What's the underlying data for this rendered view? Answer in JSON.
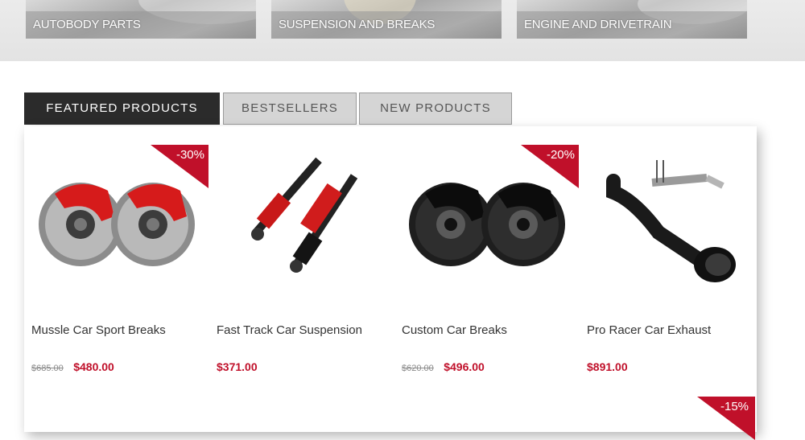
{
  "categories": [
    {
      "label": "AUTOBODY PARTS"
    },
    {
      "label": "SUSPENSION AND BREAKS"
    },
    {
      "label": "ENGINE AND DRIVETRAIN"
    }
  ],
  "tabs": [
    {
      "label": "FEATURED PRODUCTS",
      "active": true
    },
    {
      "label": "BESTSELLERS",
      "active": false
    },
    {
      "label": "NEW PRODUCTS",
      "active": false
    }
  ],
  "products": [
    {
      "name": "Mussle Car Sport Breaks",
      "old_price": "$685.00",
      "price": "$480.00",
      "discount": "-30%",
      "icon": "red-brake-kit-image"
    },
    {
      "name": "Fast Track Car Suspension",
      "old_price": "",
      "price": "$371.00",
      "discount": "",
      "icon": "coilover-suspension-image"
    },
    {
      "name": "Custom Car Breaks",
      "old_price": "$620.00",
      "price": "$496.00",
      "discount": "-20%",
      "icon": "black-brake-kit-image"
    },
    {
      "name": "Pro Racer Car Exhaust",
      "old_price": "",
      "price": "$891.00",
      "discount": "",
      "icon": "exhaust-pipe-image"
    }
  ],
  "next_row_badge": "-15%",
  "colors": {
    "accent": "#c0102a",
    "tab_active": "#2b2b2b",
    "tab_inactive": "#d5d5d5"
  }
}
